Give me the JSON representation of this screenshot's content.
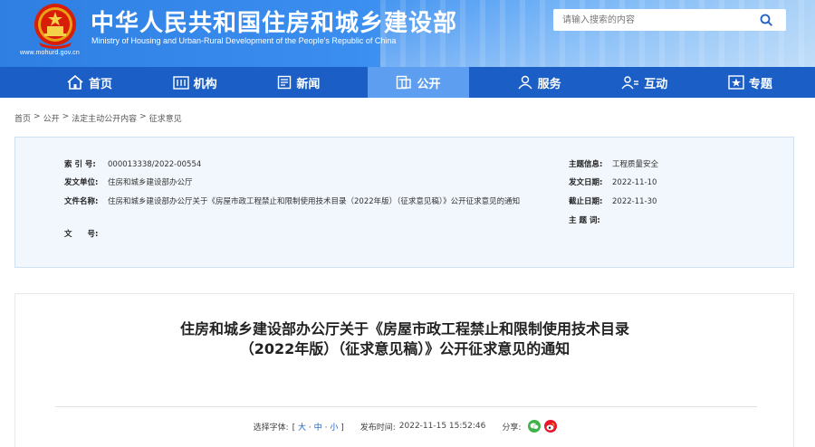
{
  "header": {
    "title_cn": "中华人民共和国住房和城乡建设部",
    "title_en": "Ministry of Housing and Urban-Rural Development of the People's Republic of China",
    "site_url": "www.mohurd.gov.cn",
    "search_placeholder": "请输入搜索的内容",
    "colors": {
      "header_blue": "#2f7fe3",
      "nav_blue": "#1b5fc6",
      "nav_active": "#5d9ef1"
    }
  },
  "nav": {
    "items": [
      {
        "label": "首页",
        "icon": "home-icon"
      },
      {
        "label": "机构",
        "icon": "building-icon"
      },
      {
        "label": "新闻",
        "icon": "news-icon"
      },
      {
        "label": "公开",
        "icon": "document-icon",
        "active": true
      },
      {
        "label": "服务",
        "icon": "user-icon"
      },
      {
        "label": "互动",
        "icon": "interact-icon"
      },
      {
        "label": "专题",
        "icon": "star-icon"
      }
    ]
  },
  "breadcrumb": {
    "items": [
      "首页",
      "公开",
      "法定主动公开内容",
      "征求意见"
    ],
    "separator": ">"
  },
  "info": {
    "index_label": "索 引 号:",
    "index_value": "000013338/2022-00554",
    "issuer_label": "发文单位:",
    "issuer_value": "住房和城乡建设部办公厅",
    "filename_label": "文件名称:",
    "filename_value": "住房和城乡建设部办公厅关于《房屋市政工程禁止和限制使用技术目录（2022年版）（征求意见稿）》公开征求意见的通知",
    "docno_label": "文　　号:",
    "docno_value": "",
    "subject_label": "主题信息:",
    "subject_value": "工程质量安全",
    "date_label": "发文日期:",
    "date_value": "2022-11-10",
    "deadline_label": "截止日期:",
    "deadline_value": "2022-11-30",
    "keywords_label": "主 题 词:",
    "keywords_value": ""
  },
  "article": {
    "title": "住房和城乡建设部办公厅关于《房屋市政工程禁止和限制使用技术目录（2022年版）（征求意见稿）》公开征求意见的通知",
    "font_select_label": "选择字体:",
    "font_open": "[",
    "font_large": "大",
    "font_medium": "中",
    "font_small": "小",
    "font_sep": "·",
    "font_close": "]",
    "publish_label": "发布时间:",
    "publish_time": "2022-11-15 15:52:46",
    "share_label": "分享:"
  }
}
